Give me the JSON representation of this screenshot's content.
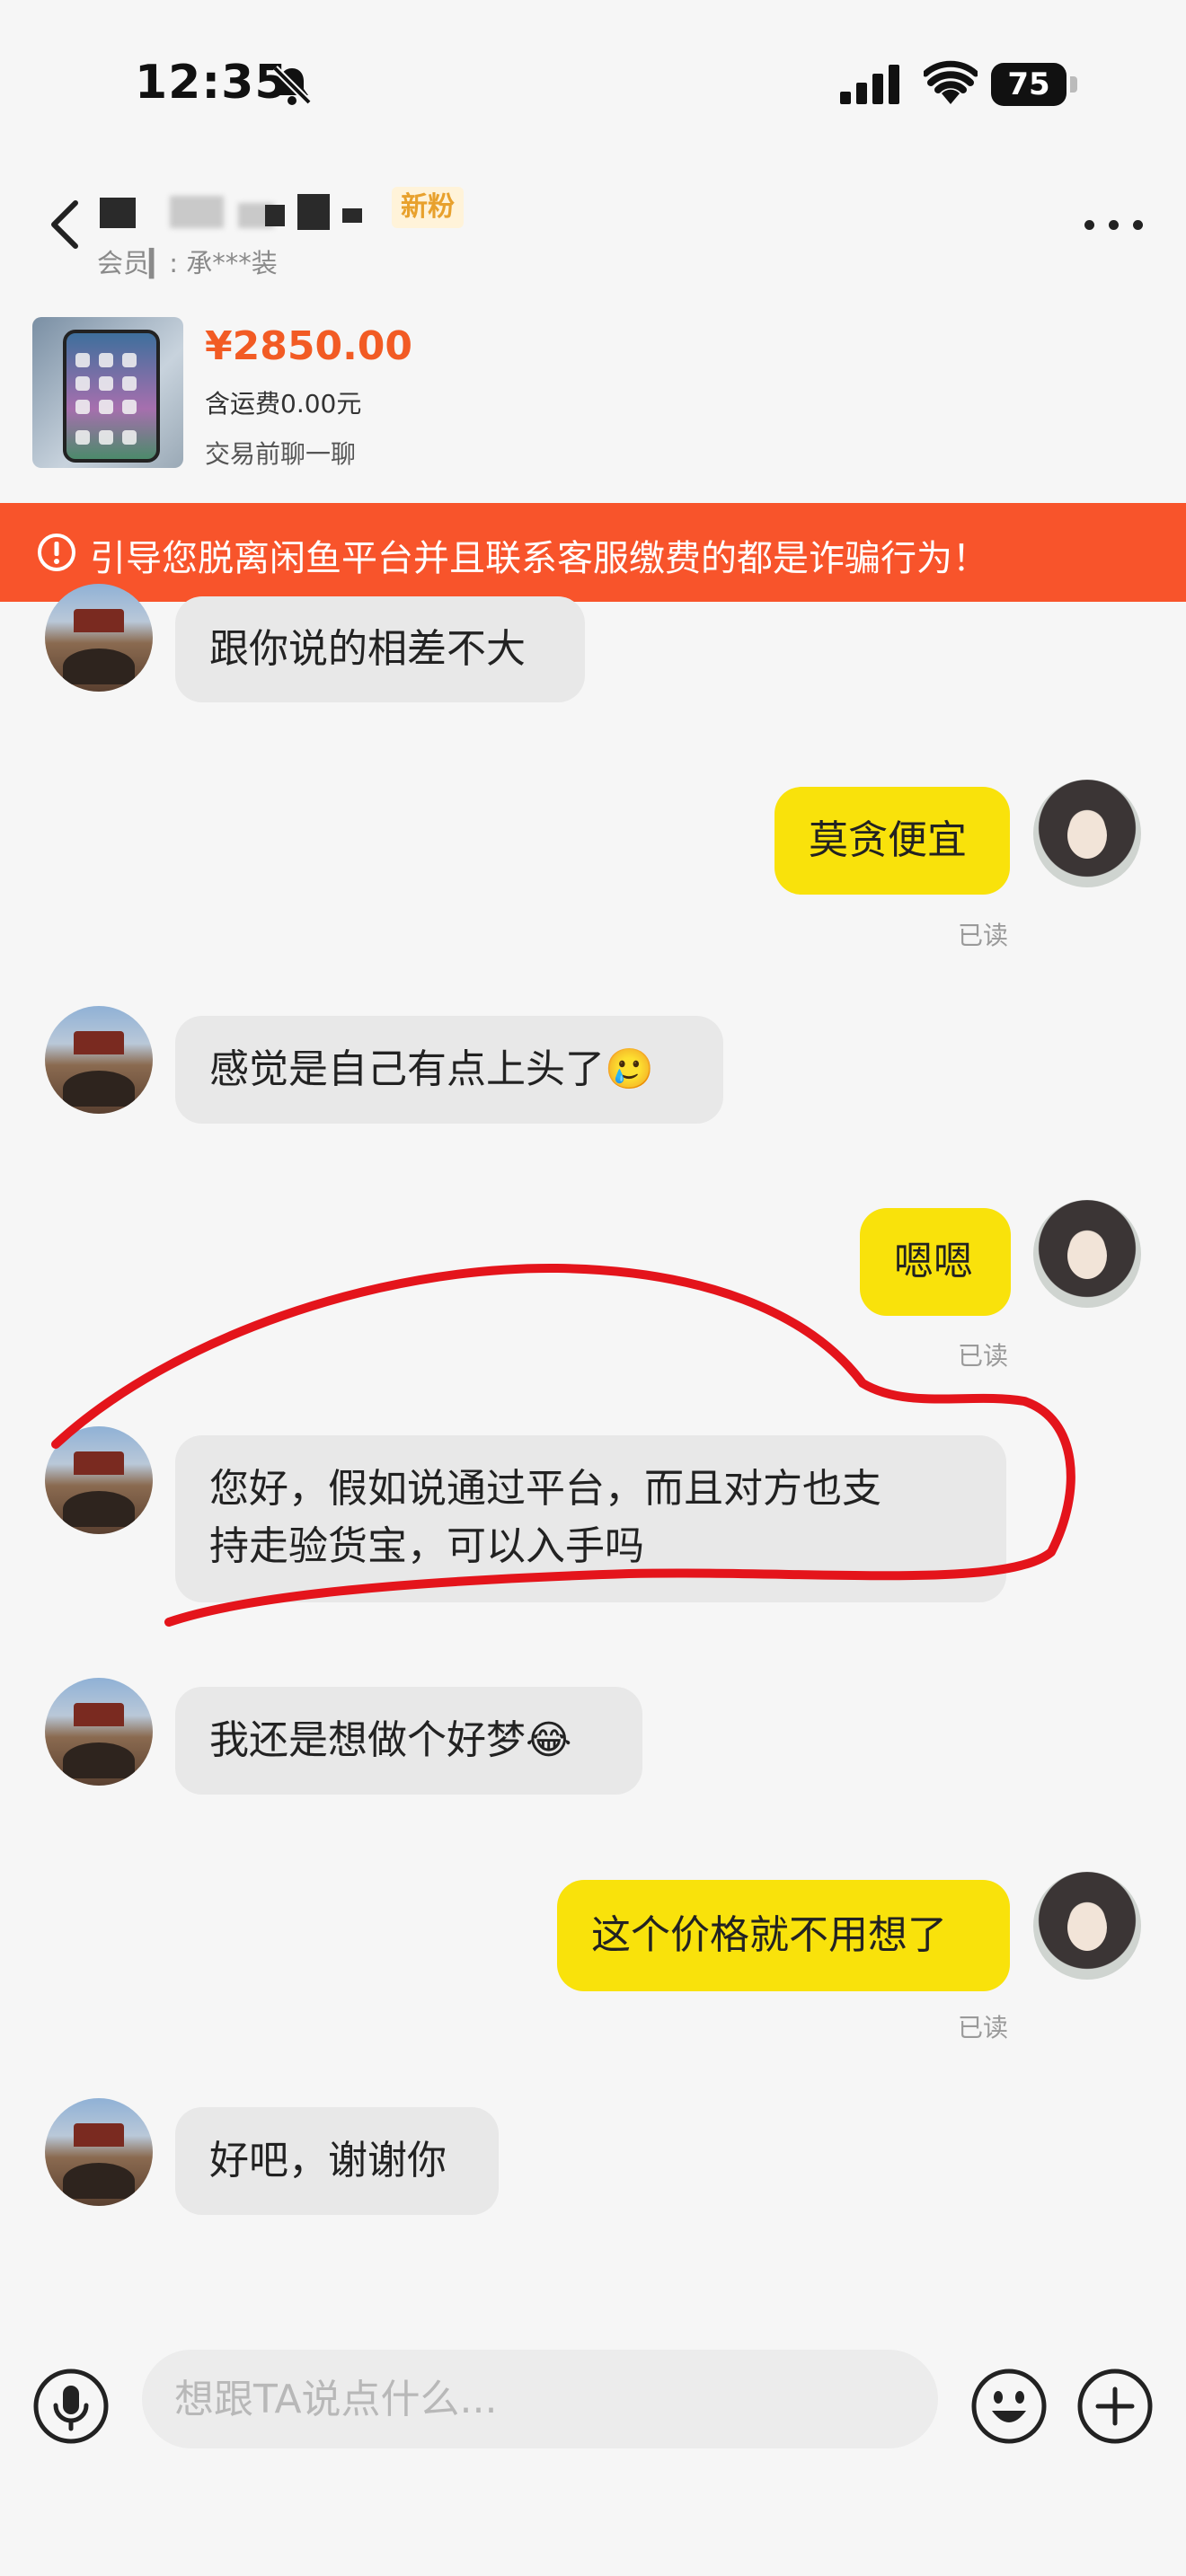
{
  "status_bar": {
    "time": "12:35",
    "battery": "75"
  },
  "header": {
    "badge": "新粉",
    "member_label": "会员▎: 承***装"
  },
  "product": {
    "price": "¥2850.00",
    "shipping": "含运费0.00元",
    "hint": "交易前聊一聊"
  },
  "warning": {
    "text": "引导您脱离闲鱼平台并且联系客服缴费的都是诈骗行为！"
  },
  "messages": [
    {
      "side": "in",
      "text": "跟你说的相差不大"
    },
    {
      "side": "out",
      "text": "莫贪便宜",
      "status": "已读"
    },
    {
      "side": "in",
      "text": "感觉是自己有点上头了🥲"
    },
    {
      "side": "out",
      "text": "嗯嗯",
      "status": "已读"
    },
    {
      "side": "in",
      "text": "您好，假如说通过平台，而且对方也支持走验货宝，可以入手吗",
      "line1": "您好，假如说通过平台，而且对方也支",
      "line2": "持走验货宝，可以入手吗"
    },
    {
      "side": "in",
      "text": "我还是想做个好梦😂"
    },
    {
      "side": "out",
      "text": "这个价格就不用想了",
      "status": "已读"
    },
    {
      "side": "in",
      "text": "好吧，谢谢你"
    }
  ],
  "input": {
    "placeholder": "想跟TA说点什么..."
  },
  "icons": {
    "back": "chevron-left-icon",
    "more": "more-dots-icon",
    "warning": "warning-circle-icon",
    "mic": "microphone-icon",
    "emoji": "emoji-icon",
    "add": "plus-circle-icon",
    "bell": "bell-slash-icon",
    "signal": "cellular-signal-icon",
    "wifi": "wifi-icon"
  },
  "colors": {
    "accent_orange": "#f8542b",
    "price": "#f25b24",
    "my_bubble": "#f9e20b",
    "their_bubble": "#e8e8e8",
    "annotation": "#e4141b"
  }
}
